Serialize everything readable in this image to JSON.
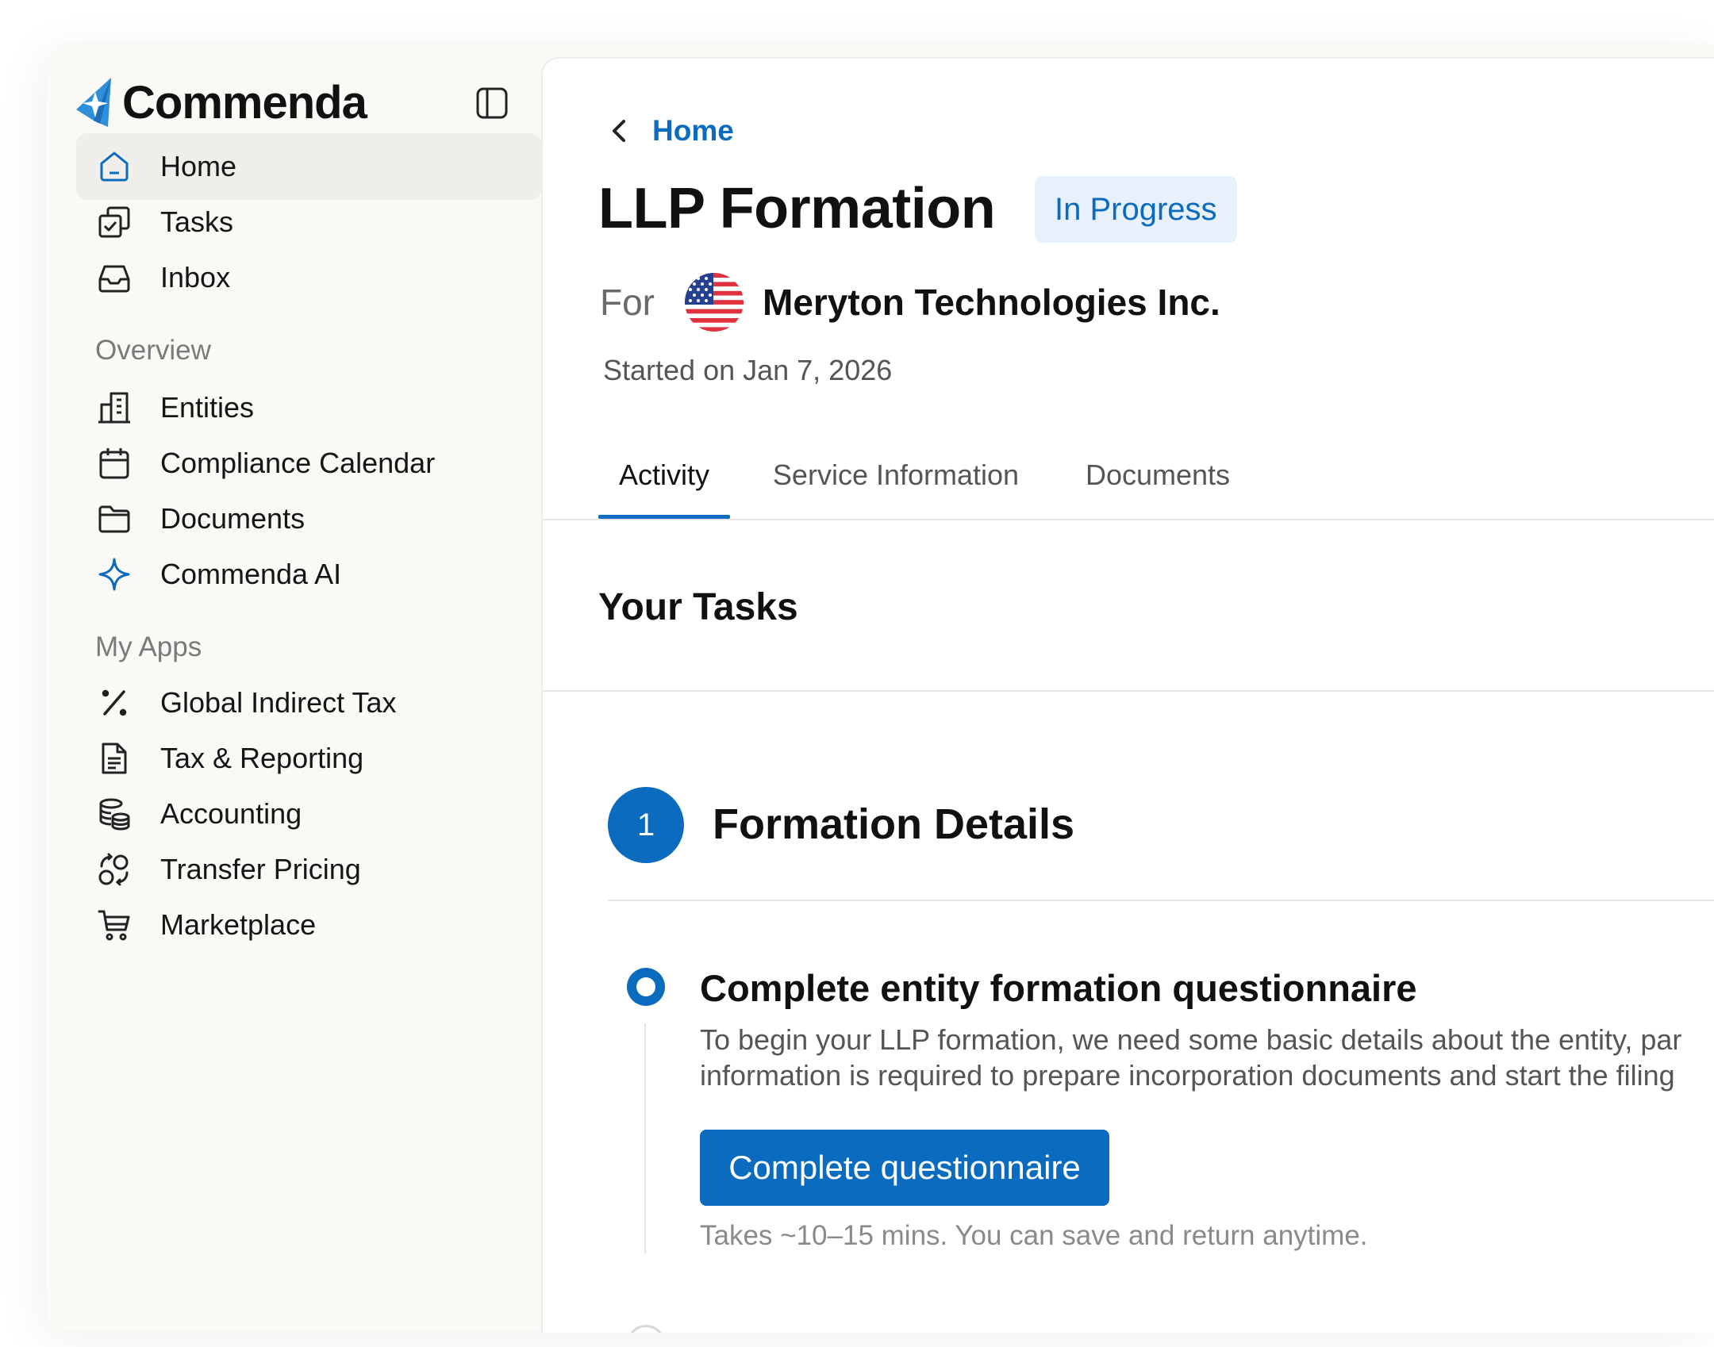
{
  "brand": {
    "name": "Commenda",
    "accent": "#0b6bbf",
    "logo_blue": "#2f8fd8"
  },
  "sidebar": {
    "primary": [
      {
        "label": "Home",
        "icon": "home-icon",
        "active": true
      },
      {
        "label": "Tasks",
        "icon": "tasks-icon"
      },
      {
        "label": "Inbox",
        "icon": "inbox-icon"
      }
    ],
    "overview_label": "Overview",
    "overview": [
      {
        "label": "Entities",
        "icon": "building-icon"
      },
      {
        "label": "Compliance Calendar",
        "icon": "calendar-icon"
      },
      {
        "label": "Documents",
        "icon": "folder-icon"
      },
      {
        "label": "Commenda AI",
        "icon": "sparkle-icon"
      }
    ],
    "apps_label": "My Apps",
    "apps": [
      {
        "label": "Global Indirect Tax",
        "icon": "percent-icon"
      },
      {
        "label": "Tax & Reporting",
        "icon": "document-icon"
      },
      {
        "label": "Accounting",
        "icon": "coins-icon"
      },
      {
        "label": "Transfer Pricing",
        "icon": "transfer-icon"
      },
      {
        "label": "Marketplace",
        "icon": "cart-icon"
      }
    ]
  },
  "header": {
    "back_label": "Home",
    "title": "LLP Formation",
    "status": "In Progress",
    "for_label": "For",
    "company": "Meryton Technologies Inc.",
    "flag_icon": "us-flag-icon",
    "started": "Started on Jan 7, 2026"
  },
  "tabs": [
    {
      "label": "Activity",
      "active": true
    },
    {
      "label": "Service Information"
    },
    {
      "label": "Documents"
    }
  ],
  "tasks_heading": "Your Tasks",
  "step": {
    "number": "1",
    "title": "Formation Details",
    "task": {
      "title": "Complete entity formation questionnaire",
      "desc_line1": "To begin your LLP formation, we need some basic details about the entity, par",
      "desc_line2": "information is required to prepare incorporation documents and start the filing",
      "button": "Complete questionnaire",
      "hint": "Takes ~10–15 mins. You can save and return anytime."
    }
  }
}
